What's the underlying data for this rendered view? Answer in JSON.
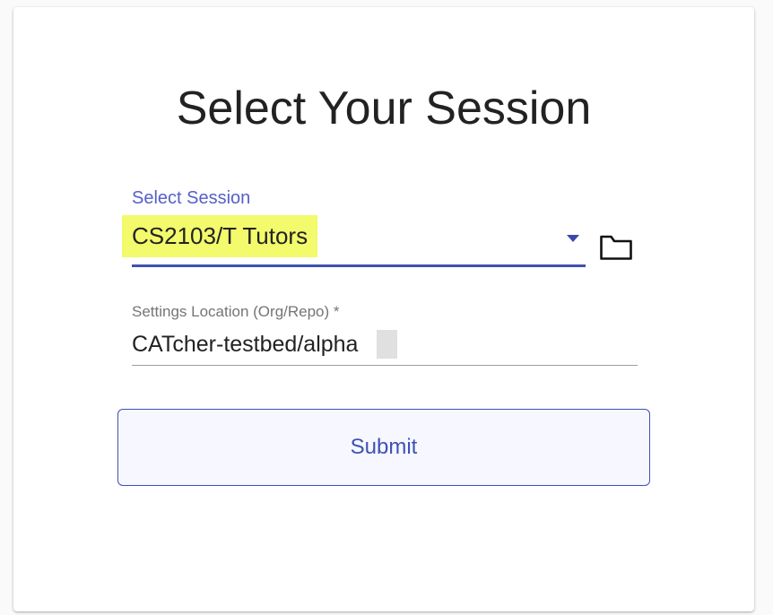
{
  "page": {
    "title": "Select Your Session"
  },
  "session_select": {
    "label": "Select Session",
    "value": "CS2103/T Tutors",
    "dropdown_icon": "caret-down-icon",
    "highlight_color": "#f3fa6b"
  },
  "folder_button": {
    "icon": "folder-icon"
  },
  "settings_location": {
    "label": "Settings Location (Org/Repo) *",
    "value": "CATcher-testbed/alpha"
  },
  "submit": {
    "label": "Submit"
  },
  "colors": {
    "accent": "#3f51b5",
    "label_blue": "#5560c7",
    "text": "#222222",
    "muted": "#757575",
    "button_bg": "#f6f7ff"
  }
}
